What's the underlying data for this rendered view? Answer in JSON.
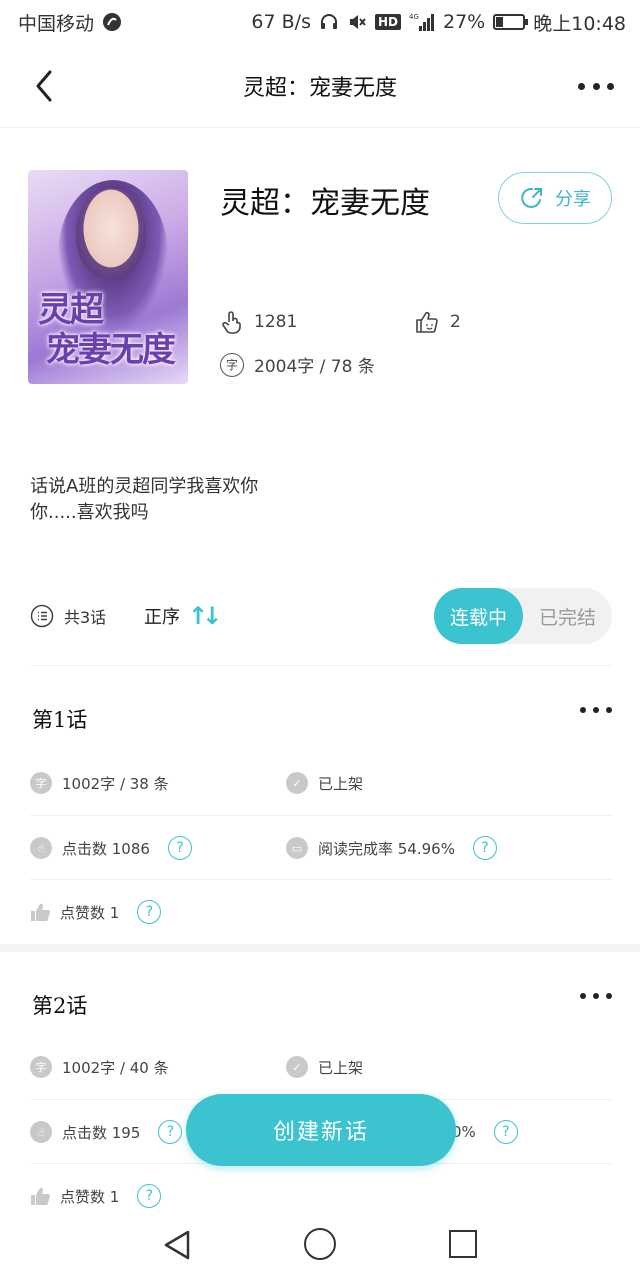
{
  "status_bar": {
    "carrier": "中国移动",
    "speed": "67 B/s",
    "hd": "HD",
    "network": "4G",
    "battery": "27%",
    "battery_level": 0.27,
    "time": "晚上10:48"
  },
  "nav": {
    "title": "灵超：宠妻无度",
    "back_icon": "chevron-left-icon",
    "more_icon": "more-horizontal-icon"
  },
  "book": {
    "cover_title_line1": "灵超",
    "cover_title_line2": "宠妻无度",
    "title": "灵超：宠妻无度",
    "share_label": "分享",
    "clicks": "1281",
    "likes": "2",
    "words": "2004字 / 78 条",
    "word_icon_char": "字",
    "description": "话说A班的灵超同学我喜欢你\n你.....喜欢我吗"
  },
  "toolbar": {
    "episode_count": "共3话",
    "sort_label": "正序",
    "sort_arrows": "↑↓",
    "seg_serializing": "连载中",
    "seg_finished": "已完结",
    "seg_active": "连载中"
  },
  "episodes": [
    {
      "title": "第1话",
      "words": "1002字 / 38 条",
      "status": "已上架",
      "clicks": "点击数 1086",
      "completion": "阅读完成率 54.96%",
      "likes": "点赞数 1"
    },
    {
      "title": "第2话",
      "words": "1002字 / 40 条",
      "status": "已上架",
      "clicks": "点击数 195",
      "completion": "0%",
      "likes": "点赞数 1"
    }
  ],
  "help_glyph": "?",
  "create_button": "创建新话",
  "colors": {
    "accent": "#3bc3cf",
    "share_border": "#7fd4dc",
    "grey_icon": "#c9c9c9"
  }
}
